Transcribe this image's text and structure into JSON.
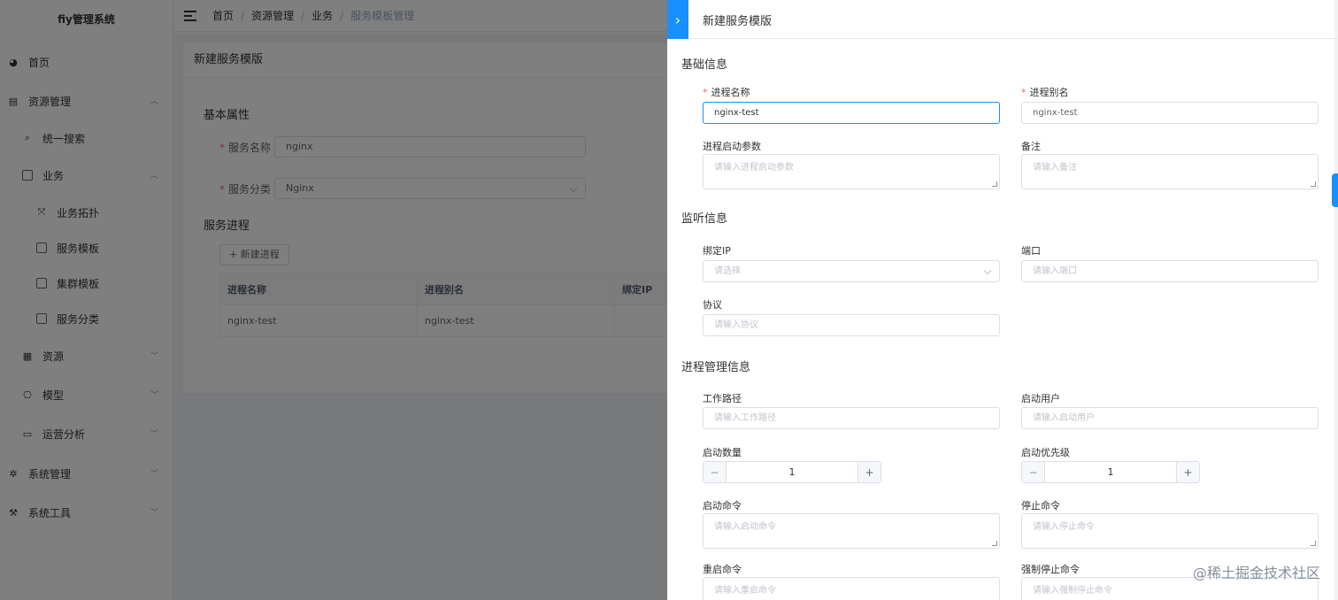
{
  "app": {
    "title": "fiy管理系统"
  },
  "sidebar": {
    "items": [
      {
        "label": "首页",
        "icon": "dashboard-icon"
      },
      {
        "label": "资源管理",
        "icon": "database-icon",
        "expanded": true
      },
      {
        "label": "统一搜索",
        "icon": "search-icon"
      },
      {
        "label": "业务",
        "icon": "business-icon",
        "expanded": true
      },
      {
        "label": "业务拓扑",
        "icon": "topology-icon"
      },
      {
        "label": "服务模板",
        "icon": "template-icon"
      },
      {
        "label": "集群模板",
        "icon": "cluster-icon"
      },
      {
        "label": "服务分类",
        "icon": "category-icon"
      },
      {
        "label": "资源",
        "icon": "resource-icon"
      },
      {
        "label": "模型",
        "icon": "model-icon"
      },
      {
        "label": "运营分析",
        "icon": "analytics-icon"
      },
      {
        "label": "系统管理",
        "icon": "settings-icon"
      },
      {
        "label": "系统工具",
        "icon": "tools-icon"
      }
    ]
  },
  "breadcrumb": [
    "首页",
    "资源管理",
    "业务",
    "服务模板管理"
  ],
  "page": {
    "card_title": "新建服务模版",
    "basic_section": "基本属性",
    "service_name_label": "服务名称",
    "service_name_value": "nginx",
    "service_category_label": "服务分类",
    "service_category_value": "Nginx",
    "process_section": "服务进程",
    "new_process_button": "+ 新建进程",
    "table": {
      "headers": [
        "进程名称",
        "进程别名",
        "绑定IP"
      ],
      "rows": [
        [
          "nginx-test",
          "nginx-test",
          ""
        ]
      ]
    }
  },
  "drawer": {
    "title": "新建服务模版",
    "sections": {
      "basic": "基础信息",
      "listen": "监听信息",
      "manage": "进程管理信息"
    },
    "fields": {
      "process_name": {
        "label": "进程名称",
        "value": "nginx-test"
      },
      "process_alias": {
        "label": "进程别名",
        "value": "nginx-test"
      },
      "start_params": {
        "label": "进程启动参数",
        "placeholder": "请输入进程启动参数"
      },
      "remark": {
        "label": "备注",
        "placeholder": "请输入备注"
      },
      "bind_ip": {
        "label": "绑定IP",
        "placeholder": "请选择"
      },
      "port": {
        "label": "端口",
        "placeholder": "请输入端口"
      },
      "protocol": {
        "label": "协议",
        "placeholder": "请输入协议"
      },
      "work_path": {
        "label": "工作路径",
        "placeholder": "请输入工作路径"
      },
      "start_user": {
        "label": "启动用户",
        "placeholder": "请输入启动用户"
      },
      "start_count": {
        "label": "启动数量",
        "value": "1"
      },
      "start_priority": {
        "label": "启动优先级",
        "value": "1"
      },
      "start_cmd": {
        "label": "启动命令",
        "placeholder": "请输入启动命令"
      },
      "stop_cmd": {
        "label": "停止命令",
        "placeholder": "请输入停止命令"
      },
      "restart_cmd": {
        "label": "重启命令",
        "placeholder": "请输入重启命令"
      },
      "force_stop_cmd": {
        "label": "强制停止命令",
        "placeholder": "请输入强制停止命令"
      }
    }
  },
  "watermark": "@稀土掘金技术社区",
  "colors": {
    "primary": "#1890ff",
    "required": "#f56c6c",
    "mask": "rgba(0,0,0,0.5)"
  }
}
